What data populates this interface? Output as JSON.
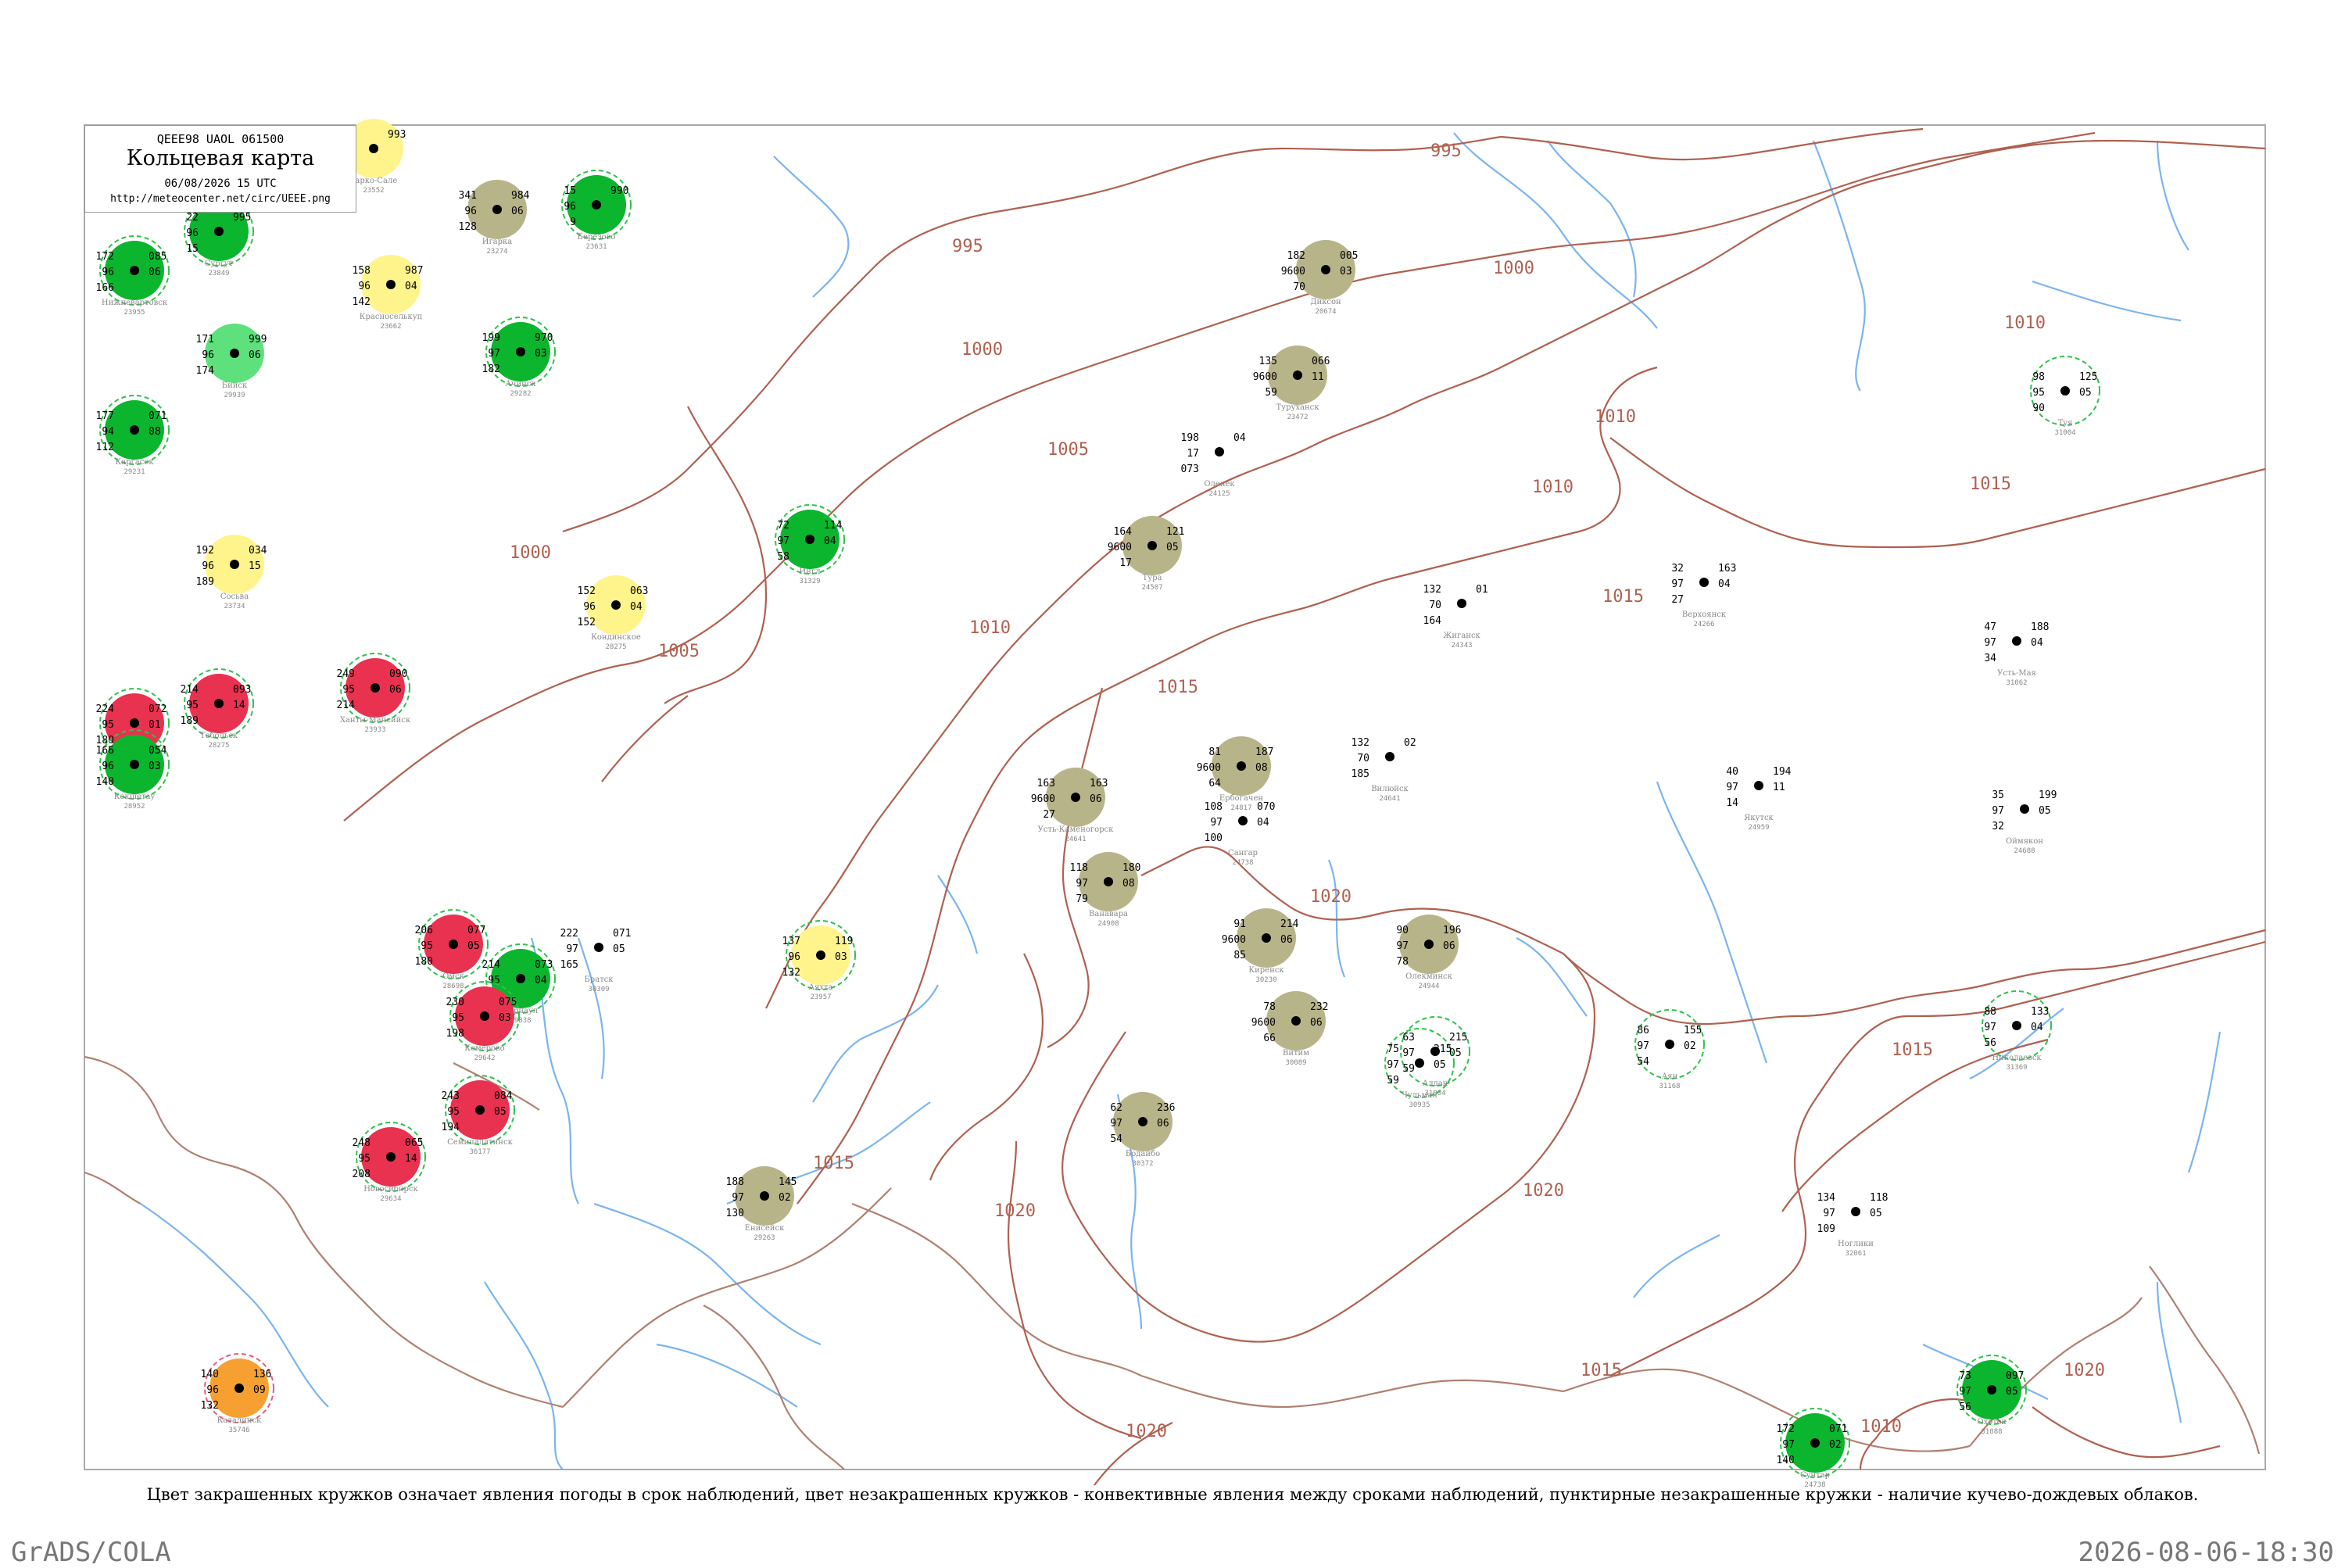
{
  "header": {
    "code": "QEEE98  UAOL  061500",
    "title": "Кольцевая карта",
    "datetime": "06/08/2026 15 UTC",
    "url": "http://meteocenter.net/circ/UEEE.png"
  },
  "caption": "Цвет закрашенных кружков означает явления погоды в срок наблюдений, цвет незакрашенных кружков - конвективные явления между сроками наблюдений, пунктирные незакрашенные кружки - наличие кучево-дождевых облаков.",
  "footer": {
    "left": "GrADS/COLA",
    "right": "2026-08-06-18:30"
  },
  "colors": {
    "isobar": "#b06050",
    "river": "#7ab4f0",
    "border": "#b08070",
    "frame": "#aaaaaa",
    "green_fill": "#0bb52e",
    "red_fill": "#e8324f",
    "olive_fill": "#b8b48a",
    "yellow_fill": "#fff48c",
    "orange_fill": "#f5a030",
    "light_green_fill": "#5ee07c",
    "green_ring": "#2ec24a",
    "red_ring": "#e85a7a"
  },
  "isobar_labels": [
    "995",
    "995",
    "1000",
    "1000",
    "1000",
    "1005",
    "1005",
    "1010",
    "1010",
    "1010",
    "1010",
    "1015",
    "1015",
    "1015",
    "1015",
    "1015",
    "1015",
    "1020",
    "1020",
    "1020",
    "1020",
    "1020",
    "1010"
  ],
  "stations": [
    {
      "name": "Усть-Каменогорск",
      "id": "24641",
      "fill": "olive",
      "ring": "none",
      "values": [
        "163",
        "9600",
        "27",
        "163",
        "06"
      ]
    },
    {
      "name": "Жиганск",
      "id": "24343",
      "fill": "none",
      "ring": "none",
      "values": [
        "132",
        "70",
        "164",
        "01"
      ]
    },
    {
      "name": "Вилюйск",
      "id": "24641",
      "fill": "none",
      "ring": "none",
      "values": [
        "132",
        "70",
        "185",
        "02"
      ]
    },
    {
      "name": "Сангар",
      "id": "24738",
      "fill": "none",
      "ring": "none",
      "values": [
        "108",
        "97",
        "100",
        "070",
        "04"
      ]
    },
    {
      "name": "Оленек",
      "id": "24125",
      "fill": "none",
      "ring": "none",
      "values": [
        "198",
        "17",
        "073",
        "04"
      ]
    },
    {
      "name": "Верхоянск",
      "id": "24266",
      "fill": "none",
      "ring": "none",
      "values": [
        "32",
        "97",
        "27",
        "163",
        "04"
      ]
    },
    {
      "name": "Усть-Мая",
      "id": "31062",
      "fill": "none",
      "ring": "none",
      "values": [
        "47",
        "97",
        "34",
        "188",
        "04"
      ]
    },
    {
      "name": "Якутск",
      "id": "24959",
      "fill": "none",
      "ring": "none",
      "values": [
        "40",
        "97",
        "14",
        "194",
        "11"
      ]
    },
    {
      "name": "Оймякон",
      "id": "24688",
      "fill": "none",
      "ring": "none",
      "values": [
        "35",
        "97",
        "32",
        "199",
        "05"
      ]
    },
    {
      "name": "Алдан",
      "id": "31004",
      "fill": "none",
      "ring": "dashed-green",
      "values": [
        "63",
        "97",
        "59",
        "215",
        "05"
      ]
    },
    {
      "name": "Чульман",
      "id": "30935",
      "fill": "none",
      "ring": "dashed-green",
      "values": [
        "75",
        "97",
        "59",
        "215",
        "05"
      ]
    },
    {
      "name": "Туруханск",
      "id": "23472",
      "fill": "olive",
      "ring": "none",
      "values": [
        "135",
        "9600",
        "59",
        "066",
        "11"
      ]
    },
    {
      "name": "Тура",
      "id": "24507",
      "fill": "olive",
      "ring": "none",
      "values": [
        "164",
        "9600",
        "17",
        "121",
        "05"
      ]
    },
    {
      "name": "Ванавара",
      "id": "24908",
      "fill": "olive",
      "ring": "none",
      "values": [
        "118",
        "97",
        "79",
        "180",
        "08"
      ]
    },
    {
      "name": "Ербогачен",
      "id": "24817",
      "fill": "olive",
      "ring": "none",
      "values": [
        "81",
        "9600",
        "64",
        "187",
        "08"
      ]
    },
    {
      "name": "Киренск",
      "id": "30230",
      "fill": "olive",
      "ring": "none",
      "values": [
        "91",
        "9600",
        "85",
        "214",
        "06"
      ]
    },
    {
      "name": "Бодайбо",
      "id": "30372",
      "fill": "olive",
      "ring": "none",
      "values": [
        "62",
        "97",
        "54",
        "236",
        "06"
      ]
    },
    {
      "name": "Витим",
      "id": "30089",
      "fill": "olive",
      "ring": "none",
      "values": [
        "78",
        "9600",
        "66",
        "232",
        "06"
      ]
    },
    {
      "name": "Олекминск",
      "id": "24944",
      "fill": "olive",
      "ring": "none",
      "values": [
        "90",
        "97",
        "78",
        "196",
        "06"
      ]
    },
    {
      "name": "Диксон",
      "id": "20674",
      "fill": "olive",
      "ring": "none",
      "values": [
        "182",
        "9600",
        "70",
        "005",
        "03"
      ]
    },
    {
      "name": "Игарка",
      "id": "23274",
      "fill": "olive",
      "ring": "none",
      "values": [
        "341",
        "96",
        "128",
        "984",
        "06"
      ]
    },
    {
      "name": "Енисейск",
      "id": "29263",
      "fill": "olive",
      "ring": "none",
      "values": [
        "188",
        "97",
        "130",
        "145",
        "02"
      ]
    },
    {
      "name": "Сургут",
      "id": "23849",
      "fill": "green",
      "ring": "dashed-green",
      "values": [
        "22",
        "96",
        "15",
        "995"
      ]
    },
    {
      "name": "Березово",
      "id": "23631",
      "fill": "green",
      "ring": "dashed-green",
      "values": [
        "15",
        "96",
        "9",
        "990"
      ]
    },
    {
      "name": "Тарко-Сале",
      "id": "23552",
      "fill": "yellow",
      "ring": "none",
      "values": [
        "11",
        "96",
        "3",
        "993"
      ]
    },
    {
      "name": "Красноселькуп",
      "id": "23662",
      "fill": "yellow",
      "ring": "none",
      "values": [
        "158",
        "96",
        "142",
        "987",
        "04"
      ]
    },
    {
      "name": "Сосьва",
      "id": "23734",
      "fill": "yellow",
      "ring": "none",
      "values": [
        "192",
        "96",
        "189",
        "034",
        "15"
      ]
    },
    {
      "name": "Кондинское",
      "id": "28275",
      "fill": "yellow",
      "ring": "none",
      "values": [
        "152",
        "96",
        "152",
        "063",
        "04"
      ]
    },
    {
      "name": "Каргасок",
      "id": "29231",
      "fill": "green",
      "ring": "dashed-green",
      "values": [
        "177",
        "94",
        "112",
        "071",
        "08"
      ]
    },
    {
      "name": "Нижневартовск",
      "id": "23955",
      "fill": "green",
      "ring": "dashed-green",
      "values": [
        "172",
        "96",
        "166",
        "085",
        "06"
      ]
    },
    {
      "name": "Ханты-Мансийск",
      "id": "23933",
      "fill": "red",
      "ring": "dashed-green",
      "values": [
        "249",
        "95",
        "214",
        "090",
        "06"
      ]
    },
    {
      "name": "Тобольск",
      "id": "28275",
      "fill": "red",
      "ring": "dashed-green",
      "values": [
        "214",
        "95",
        "189",
        "093",
        "14"
      ]
    },
    {
      "name": "Тюмень",
      "id": "28367",
      "fill": "red",
      "ring": "dashed-green",
      "values": [
        "224",
        "95",
        "180",
        "072",
        "01"
      ]
    },
    {
      "name": "Омск",
      "id": "28698",
      "fill": "red",
      "ring": "dashed-green",
      "values": [
        "206",
        "95",
        "180",
        "077",
        "05"
      ]
    },
    {
      "name": "Кокшетау",
      "id": "28952",
      "fill": "green",
      "ring": "dashed-green",
      "values": [
        "166",
        "96",
        "140",
        "054",
        "03"
      ]
    },
    {
      "name": "Новосибирск",
      "id": "29634",
      "fill": "red",
      "ring": "dashed-green",
      "values": [
        "248",
        "95",
        "208",
        "065",
        "14"
      ]
    },
    {
      "name": "Барнаул",
      "id": "29838",
      "fill": "green",
      "ring": "dashed-green",
      "values": [
        "214",
        "95",
        "194",
        "073",
        "04"
      ]
    },
    {
      "name": "Кемерово",
      "id": "29642",
      "fill": "red",
      "ring": "dashed-green",
      "values": [
        "230",
        "95",
        "198",
        "075",
        "03"
      ]
    },
    {
      "name": "Семипалатинск",
      "id": "36177",
      "fill": "red",
      "ring": "dashed-green",
      "values": [
        "243",
        "95",
        "194",
        "084",
        "05"
      ]
    },
    {
      "name": "Бийск",
      "id": "29939",
      "fill": "light-green",
      "ring": "none",
      "values": [
        "171",
        "96",
        "174",
        "999",
        "06"
      ]
    },
    {
      "name": "Ачинск",
      "id": "29282",
      "fill": "green",
      "ring": "dashed-green",
      "values": [
        "199",
        "97",
        "182",
        "970",
        "03"
      ]
    },
    {
      "name": "Ингл",
      "id": "31329",
      "fill": "green",
      "ring": "dashed-green",
      "values": [
        "72",
        "97",
        "58",
        "114",
        "04"
      ]
    },
    {
      "name": "Охотск",
      "id": "31088",
      "fill": "green",
      "ring": "dashed-green",
      "values": [
        "73",
        "97",
        "56",
        "097",
        "05"
      ]
    },
    {
      "name": "Сунтар",
      "id": "24738",
      "fill": "green",
      "ring": "dashed-green",
      "values": [
        "172",
        "97",
        "140",
        "071",
        "02"
      ]
    },
    {
      "name": "Казалинск",
      "id": "35746",
      "fill": "orange",
      "ring": "dashed-red",
      "values": [
        "140",
        "96",
        "132",
        "136",
        "09"
      ]
    },
    {
      "name": "Аяхта",
      "id": "23957",
      "fill": "yellow",
      "ring": "dashed-green",
      "values": [
        "137",
        "96",
        "132",
        "119",
        "03"
      ]
    },
    {
      "name": "Туя",
      "id": "31004",
      "fill": "none",
      "ring": "dashed-green",
      "values": [
        "98",
        "95",
        "90",
        "125",
        "05"
      ]
    },
    {
      "name": "Николаевск",
      "id": "31369",
      "fill": "none",
      "ring": "dashed-green",
      "values": [
        "88",
        "97",
        "56",
        "133",
        "04"
      ]
    },
    {
      "name": "Аян",
      "id": "31168",
      "fill": "none",
      "ring": "dashed-green",
      "values": [
        "86",
        "97",
        "54",
        "155",
        "02"
      ]
    },
    {
      "name": "Братск",
      "id": "30309",
      "fill": "none",
      "ring": "none",
      "values": [
        "222",
        "97",
        "165",
        "071",
        "05"
      ]
    },
    {
      "name": "Ноглики",
      "id": "32061",
      "fill": "none",
      "ring": "none",
      "values": [
        "134",
        "97",
        "109",
        "118",
        "05"
      ]
    }
  ]
}
